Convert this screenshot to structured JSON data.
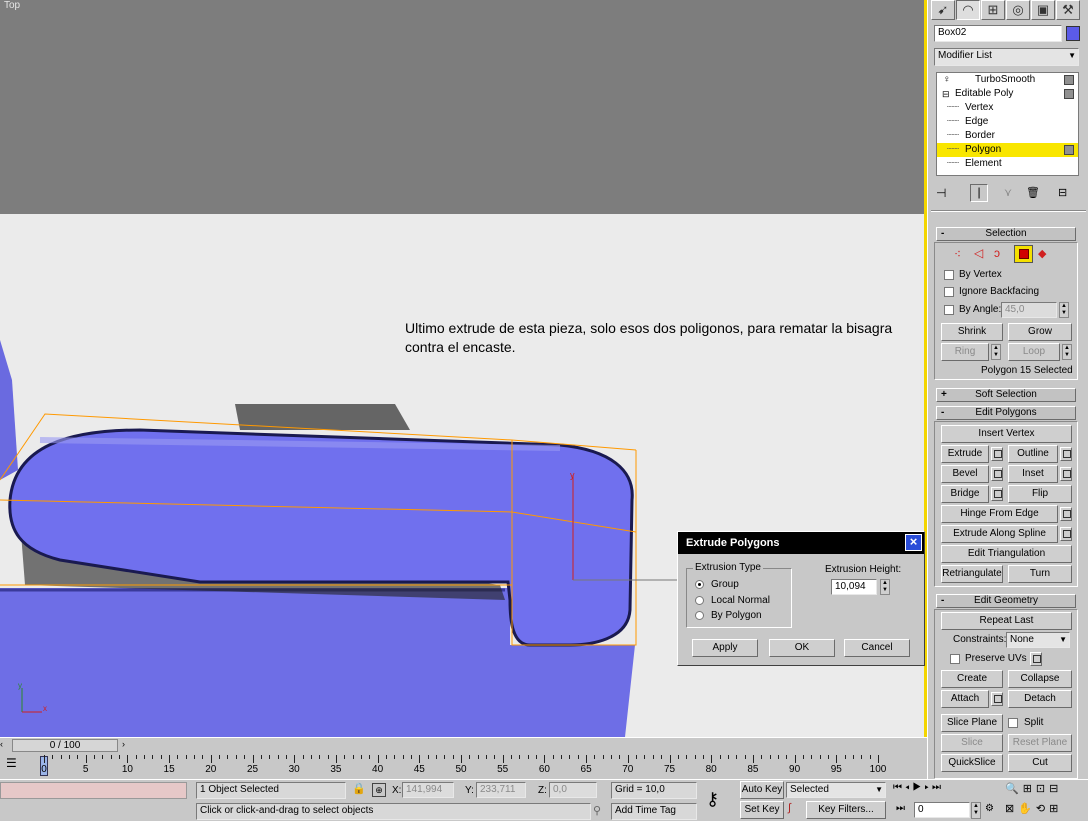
{
  "viewport": {
    "label": "Top",
    "annotation": "Ultimo extrude de esta pieza, solo esos dos poligonos, para rematar la bisagra contra el encaste."
  },
  "dialog": {
    "title": "Extrude Polygons",
    "close_icon": "close-icon",
    "extrusion_type_label": "Extrusion Type",
    "options": [
      "Group",
      "Local Normal",
      "By Polygon"
    ],
    "selected_option": "Group",
    "height_label": "Extrusion Height:",
    "height_value": "10,094",
    "apply": "Apply",
    "ok": "OK",
    "cancel": "Cancel"
  },
  "panel": {
    "tabs": [
      "create-icon",
      "modify-icon",
      "hierarchy-icon",
      "motion-icon",
      "display-icon",
      "utilities-icon"
    ],
    "object_name": "Box02",
    "object_color": "#5b5be8",
    "modifier_list": "Modifier List",
    "stack": [
      {
        "label": "TurboSmooth",
        "indent": 0
      },
      {
        "label": "Editable Poly",
        "indent": 0
      },
      {
        "label": "Vertex",
        "indent": 1
      },
      {
        "label": "Edge",
        "indent": 1
      },
      {
        "label": "Border",
        "indent": 1
      },
      {
        "label": "Polygon",
        "indent": 1,
        "selected": true
      },
      {
        "label": "Element",
        "indent": 1
      }
    ],
    "selection": {
      "header": "Selection",
      "by_vertex": "By Vertex",
      "ignore_backfacing": "Ignore Backfacing",
      "by_angle": "By Angle:",
      "angle_value": "45,0",
      "shrink": "Shrink",
      "grow": "Grow",
      "ring": "Ring",
      "loop": "Loop",
      "status": "Polygon 15 Selected"
    },
    "soft_selection": "Soft Selection",
    "edit_polygons": {
      "header": "Edit Polygons",
      "insert_vertex": "Insert Vertex",
      "extrude": "Extrude",
      "outline": "Outline",
      "bevel": "Bevel",
      "inset": "Inset",
      "bridge": "Bridge",
      "flip": "Flip",
      "hinge": "Hinge From Edge",
      "extrude_spline": "Extrude Along Spline",
      "edit_tri": "Edit Triangulation",
      "retriangulate": "Retriangulate",
      "turn": "Turn"
    },
    "edit_geometry": {
      "header": "Edit Geometry",
      "repeat_last": "Repeat Last",
      "constraints": "Constraints:",
      "constraints_value": "None",
      "preserve_uvs": "Preserve UVs",
      "create": "Create",
      "collapse": "Collapse",
      "attach": "Attach",
      "detach": "Detach",
      "slice_plane": "Slice Plane",
      "split": "Split",
      "slice": "Slice",
      "reset_plane": "Reset Plane",
      "quickslice": "QuickSlice",
      "cut": "Cut"
    }
  },
  "timeline": {
    "frame": "0 / 100",
    "ticks": [
      "0",
      "5",
      "10",
      "15",
      "20",
      "25",
      "30",
      "35",
      "40",
      "45",
      "50",
      "55",
      "60",
      "65",
      "70",
      "75",
      "80",
      "85",
      "90",
      "95",
      "100"
    ]
  },
  "status": {
    "selection": "1 Object Selected",
    "prompt": "Click or click-and-drag to select objects",
    "x_label": "X:",
    "x_value": "141,994",
    "y_label": "Y:",
    "y_value": "233,711",
    "z_label": "Z:",
    "z_value": "0,0",
    "grid": "Grid = 10,0",
    "add_time_tag": "Add Time Tag",
    "auto_key": "Auto Key",
    "set_key": "Set Key",
    "key_mode": "Selected",
    "key_filters": "Key Filters...",
    "current_frame": "0"
  }
}
